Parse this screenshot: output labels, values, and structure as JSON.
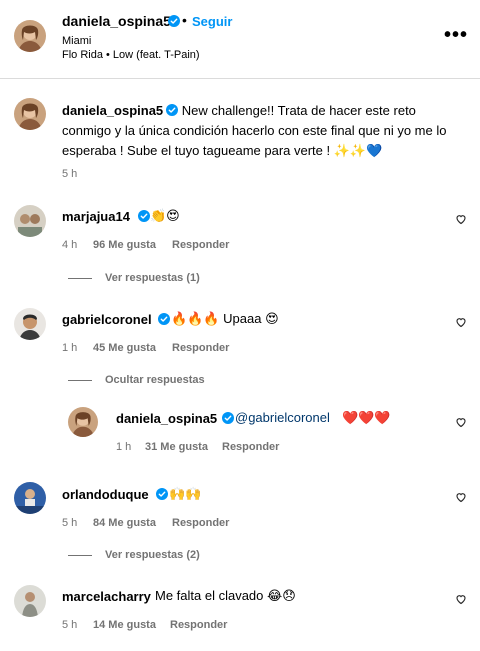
{
  "post": {
    "username": "daniela_ospina5",
    "separator": "•",
    "follow_label": "Seguir",
    "location": "Miami",
    "song": "Flo Rida • Low (feat. T-Pain)",
    "more_label": "•••"
  },
  "caption": {
    "username": "daniela_ospina5",
    "text": "New challenge!! Trata de hacer este reto conmigo y la única condición hacerlo con este final que ni yo me lo esperaba ! Sube el tuyo tagueame para verte ! ✨✨💙",
    "time": "5 h"
  },
  "comments": [
    {
      "username": "marjajua14",
      "text": "👏😍",
      "time": "4 h",
      "likes": "96 Me gusta",
      "reply_label": "Responder",
      "replies_toggle": "Ver respuestas (1)"
    },
    {
      "username": "gabrielcoronel",
      "text": "🔥🔥🔥 Upaaa 😍",
      "time": "1 h",
      "likes": "45 Me gusta",
      "reply_label": "Responder",
      "replies_toggle": "Ocultar respuestas",
      "reply": {
        "username": "daniela_ospina5",
        "mention": "@gabrielcoronel",
        "text": "❤️❤️❤️",
        "time": "1 h",
        "likes": "31 Me gusta",
        "reply_label": "Responder"
      }
    },
    {
      "username": "orlandoduque",
      "text": "🙌🙌",
      "time": "5 h",
      "likes": "84 Me gusta",
      "reply_label": "Responder",
      "replies_toggle": "Ver respuestas (2)"
    },
    {
      "username": "marcelacharry",
      "text": "Me falta el clavado 😂😞",
      "time": "5 h",
      "likes": "14 Me gusta",
      "reply_label": "Responder"
    }
  ],
  "colors": {
    "link_blue": "#0095f6",
    "verified_blue": "#0095f6",
    "muted_gray": "#737373",
    "mention_blue": "#00376b",
    "divider": "#dbdbdb"
  }
}
